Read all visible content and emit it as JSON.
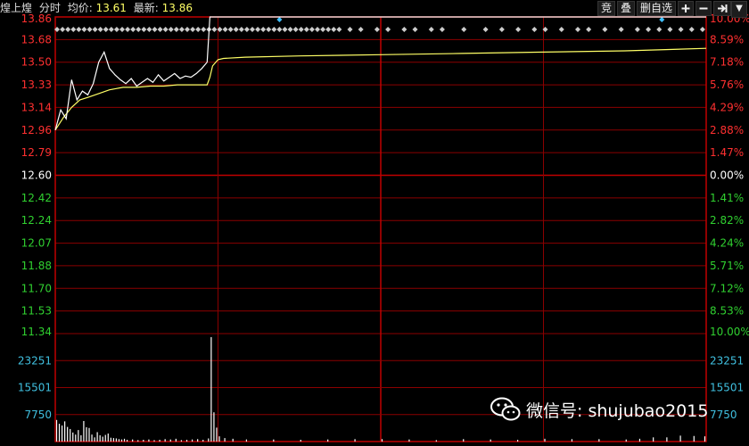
{
  "header": {
    "stock_name": "煌上煌",
    "mode": "分时",
    "avg_label": "均价:",
    "avg_value": "13.61",
    "latest_label": "最新:",
    "latest_value": "13.86"
  },
  "toolbar": {
    "auction_label": "竞",
    "overlay_label": "叠",
    "remove_fav_label": "删自选",
    "add_icon": "plus-icon",
    "minus_icon": "minus-icon",
    "jump_icon": "jump-end-icon",
    "more_icon": "chevron-down-icon"
  },
  "watermark": {
    "text": "微信号: shujubao2015",
    "icon": "wechat-icon"
  },
  "colors": {
    "background": "#000000",
    "grid": "#8b0000",
    "grid_center": "#c00000",
    "up": "#ff3030",
    "down": "#30d030",
    "neutral": "#ffffff",
    "price_line": "#ffffff",
    "avg_line": "#ffff66",
    "volume_label": "#40c0e0",
    "event_marker": "#cccccc",
    "event_marker_special": "#40c0ff"
  },
  "chart_data": {
    "type": "line",
    "prev_close": 12.6,
    "price_ticks": [
      13.86,
      13.68,
      13.5,
      13.33,
      13.14,
      12.96,
      12.79,
      12.6,
      12.42,
      12.24,
      12.07,
      11.88,
      11.7,
      11.53,
      11.34
    ],
    "pct_ticks": [
      "10.00%",
      "8.59%",
      "7.18%",
      "5.76%",
      "4.29%",
      "2.88%",
      "1.47%",
      "0.00%",
      "1.41%",
      "2.82%",
      "4.24%",
      "5.71%",
      "7.12%",
      "8.53%",
      "10.00%"
    ],
    "price_ylim": [
      11.34,
      13.86
    ],
    "minutes_total": 240,
    "price_series": {
      "name": "",
      "x": [
        0,
        2,
        4,
        6,
        8,
        10,
        12,
        14,
        16,
        18,
        20,
        22,
        24,
        26,
        28,
        30,
        32,
        34,
        36,
        38,
        40,
        42,
        44,
        46,
        48,
        50,
        52,
        54,
        56,
        57,
        58,
        60,
        240
      ],
      "y": [
        12.96,
        13.12,
        13.05,
        13.36,
        13.2,
        13.27,
        13.24,
        13.33,
        13.5,
        13.58,
        13.45,
        13.4,
        13.36,
        13.33,
        13.37,
        13.31,
        13.34,
        13.37,
        13.34,
        13.4,
        13.35,
        13.38,
        13.41,
        13.37,
        13.39,
        13.38,
        13.41,
        13.45,
        13.5,
        13.86,
        13.86,
        13.86,
        13.86
      ]
    },
    "avg_series": {
      "name": "",
      "x": [
        0,
        3,
        6,
        9,
        12,
        16,
        20,
        25,
        30,
        35,
        40,
        45,
        50,
        54,
        56,
        57,
        58,
        60,
        62,
        70,
        90,
        120,
        150,
        180,
        210,
        240
      ],
      "y": [
        12.96,
        13.06,
        13.14,
        13.2,
        13.22,
        13.25,
        13.28,
        13.3,
        13.3,
        13.31,
        13.31,
        13.32,
        13.32,
        13.32,
        13.32,
        13.38,
        13.47,
        13.52,
        13.53,
        13.54,
        13.55,
        13.56,
        13.57,
        13.58,
        13.59,
        13.61
      ]
    },
    "volume": {
      "ticks": [
        "23251",
        "15501",
        "7750"
      ],
      "ylim": [
        0,
        31000
      ],
      "x": [
        0,
        1,
        2,
        3,
        4,
        5,
        6,
        7,
        8,
        9,
        10,
        11,
        12,
        13,
        14,
        15,
        16,
        17,
        18,
        19,
        20,
        21,
        22,
        23,
        24,
        25,
        26,
        28,
        30,
        32,
        34,
        36,
        38,
        40,
        42,
        44,
        46,
        48,
        50,
        52,
        54,
        56,
        57,
        58,
        59,
        60,
        62,
        65,
        70,
        80,
        90,
        100,
        110,
        120,
        130,
        140,
        150,
        160,
        170,
        180,
        190,
        200,
        210,
        215,
        220,
        225,
        230,
        235,
        239
      ],
      "values": [
        6200,
        5100,
        4600,
        5800,
        4200,
        3600,
        2600,
        2000,
        3300,
        1800,
        5900,
        4100,
        3900,
        2000,
        1200,
        2700,
        1800,
        1400,
        1900,
        2300,
        1100,
        1000,
        900,
        700,
        600,
        800,
        500,
        600,
        400,
        500,
        600,
        400,
        500,
        700,
        600,
        800,
        400,
        500,
        600,
        700,
        500,
        900,
        30000,
        8400,
        4000,
        1500,
        1000,
        800,
        600,
        600,
        500,
        600,
        700,
        700,
        600,
        400,
        700,
        600,
        500,
        800,
        700,
        700,
        600,
        800,
        1200,
        1200,
        1700,
        1600,
        1500
      ]
    },
    "events": {
      "x": [
        0,
        2,
        4,
        6,
        8,
        10,
        12,
        14,
        16,
        18,
        20,
        22,
        24,
        26,
        28,
        30,
        32,
        34,
        36,
        38,
        40,
        42,
        44,
        46,
        48,
        50,
        52,
        54,
        56,
        58,
        60,
        62,
        64,
        66,
        68,
        70,
        72,
        74,
        76,
        78,
        80,
        82,
        84,
        86,
        88,
        90,
        92,
        94,
        96,
        98,
        100,
        102,
        104,
        108,
        112,
        118,
        122,
        128,
        132,
        138,
        142,
        150,
        158,
        164,
        170,
        176,
        180,
        186,
        192,
        196,
        202,
        208,
        214,
        218,
        222,
        226,
        230,
        234,
        238
      ],
      "special_x": [
        82,
        223
      ]
    }
  }
}
